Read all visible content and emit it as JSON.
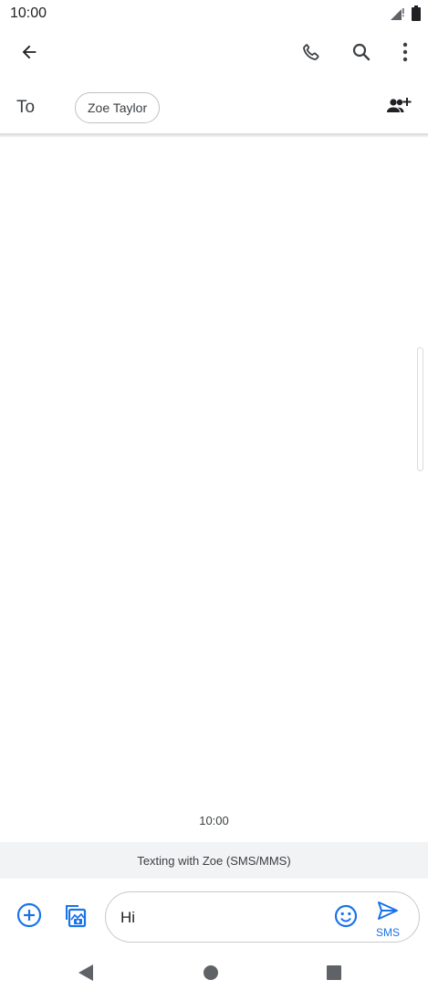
{
  "status_bar": {
    "time": "10:00",
    "icons": [
      "signal-icon",
      "battery-icon"
    ]
  },
  "app_bar": {
    "icons": [
      "back-arrow-icon",
      "phone-icon",
      "search-icon",
      "more-vert-icon"
    ]
  },
  "recipient": {
    "to_label": "To",
    "chip_name": "Zoe Taylor",
    "add_icon": "add-people-icon"
  },
  "conversation": {
    "timestamp": "10:00"
  },
  "banner": {
    "text": "Texting with Zoe (SMS/MMS)"
  },
  "compose": {
    "message_text": "Hi",
    "send_label": "SMS",
    "icons": [
      "add-circle-icon",
      "gallery-icon",
      "emoji-icon",
      "send-icon"
    ]
  },
  "nav_bar": {
    "icons": [
      "nav-back-icon",
      "nav-home-icon",
      "nav-recents-icon"
    ]
  },
  "colors": {
    "accent": "#1a73e8",
    "banner_bg": "#f1f3f4",
    "icon_dark": "#3c4043"
  }
}
